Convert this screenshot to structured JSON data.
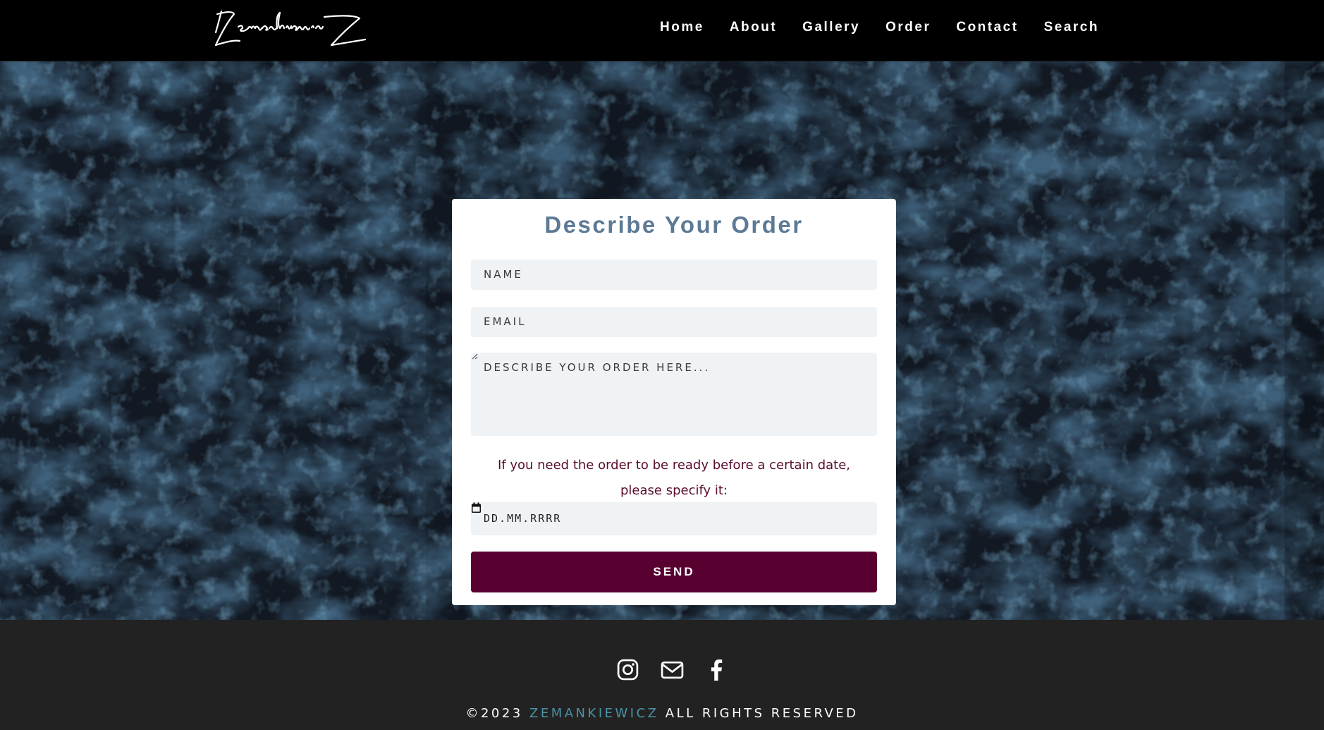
{
  "nav": {
    "logo_text": "Zemankiewicz",
    "links": [
      {
        "label": "Home"
      },
      {
        "label": "About"
      },
      {
        "label": "Gallery"
      },
      {
        "label": "Order"
      },
      {
        "label": "Contact"
      },
      {
        "label": "Search"
      }
    ]
  },
  "form": {
    "title": "Describe Your Order",
    "name_placeholder": "NAME",
    "email_placeholder": "EMAIL",
    "description_placeholder": "DESCRIBE YOUR ORDER HERE...",
    "date_hint": "If you need the order to be ready before a certain date, please specify it:",
    "date_placeholder": "DD.MM.RRRR",
    "send_label": "SEND"
  },
  "footer": {
    "socials": [
      {
        "icon": "instagram-icon"
      },
      {
        "icon": "mail-icon"
      },
      {
        "icon": "facebook-icon"
      }
    ],
    "copyright_prefix": "©2023",
    "copyright_brand": "ZEMANKIEWICZ",
    "copyright_suffix": "ALL RIGHTS RESERVED"
  },
  "colors": {
    "nav_bg": "#000000",
    "title": "#5c7a95",
    "field_bg": "#f0f3f6",
    "hint_text": "#5a0c2f",
    "send_bg": "#580131",
    "footer_bg": "#222222",
    "brand": "#4a93a8"
  }
}
